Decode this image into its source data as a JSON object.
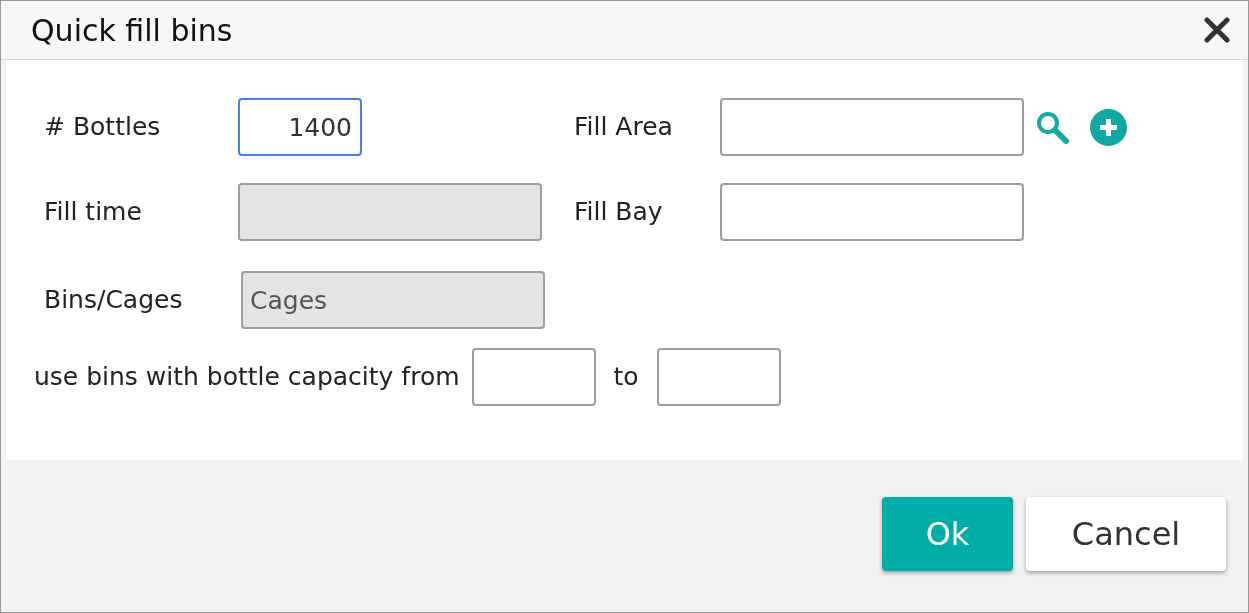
{
  "dialog": {
    "title": "Quick fill bins"
  },
  "fields": [
    {
      "label": "# Bottles",
      "value": "1400",
      "focused": true,
      "disabled": false
    },
    {
      "label": "Fill Area",
      "focused": false,
      "disabled": false
    },
    {
      "label": "Fill time",
      "focused": false,
      "disabled": true
    },
    {
      "label": "Fill Bay",
      "focused": false,
      "disabled": false
    },
    {
      "label": "Bins/Cages",
      "value": "Cages",
      "focused": false,
      "disabled": true
    }
  ],
  "capacity": {
    "label": "use bins with bottle capacity from",
    "separator": "to"
  },
  "buttons": [
    {
      "label": "Ok",
      "kind": "primary"
    },
    {
      "label": "Cancel",
      "kind": "secondary"
    }
  ]
}
